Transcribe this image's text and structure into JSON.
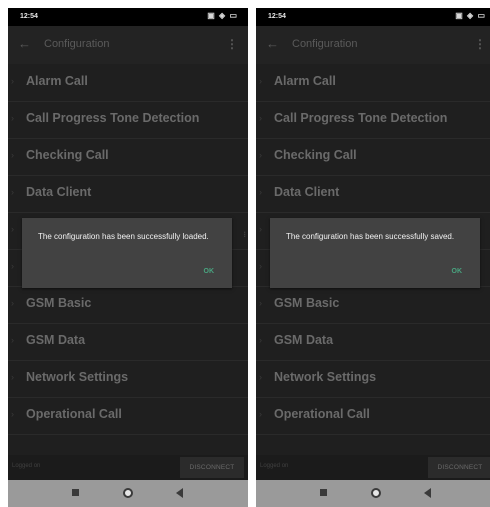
{
  "screens": [
    {
      "status": {
        "time": "12:54"
      },
      "appbar": {
        "back_glyph": "←",
        "title": "Configuration",
        "more_glyph": "⋮"
      },
      "menu": [
        {
          "label": "Alarm Call"
        },
        {
          "label": "Call Progress Tone Detection"
        },
        {
          "label": "Checking Call"
        },
        {
          "label": "Data Client"
        },
        {
          "label": ""
        },
        {
          "label": ""
        },
        {
          "label": "GSM Basic"
        },
        {
          "label": "GSM Data"
        },
        {
          "label": "Network Settings"
        },
        {
          "label": "Operational Call"
        }
      ],
      "dialog": {
        "message": "The configuration has been successfully loaded.",
        "ok_label": "OK"
      },
      "bottom": {
        "status_text": "Logged on",
        "disconnect_label": "DISCONNECT"
      }
    },
    {
      "status": {
        "time": "12:54"
      },
      "appbar": {
        "back_glyph": "←",
        "title": "Configuration",
        "more_glyph": "⋮"
      },
      "menu": [
        {
          "label": "Alarm Call"
        },
        {
          "label": "Call Progress Tone Detection"
        },
        {
          "label": "Checking Call"
        },
        {
          "label": "Data Client"
        },
        {
          "label": ""
        },
        {
          "label": ""
        },
        {
          "label": "GSM Basic"
        },
        {
          "label": "GSM Data"
        },
        {
          "label": "Network Settings"
        },
        {
          "label": "Operational Call"
        }
      ],
      "dialog": {
        "message": "The configuration has been successfully saved.",
        "ok_label": "OK"
      },
      "bottom": {
        "status_text": "Logged on",
        "disconnect_label": "DISCONNECT"
      }
    }
  ],
  "icons": {
    "status": [
      "vibrate-icon",
      "wifi-icon",
      "battery-icon"
    ],
    "nav": [
      "recent-apps-icon",
      "home-icon",
      "back-triangle-icon"
    ],
    "menu_chevron": "chevron-right-icon"
  },
  "colors": {
    "background": "#1f1f1f",
    "dialog": "#424242",
    "accent": "#49a37f"
  }
}
